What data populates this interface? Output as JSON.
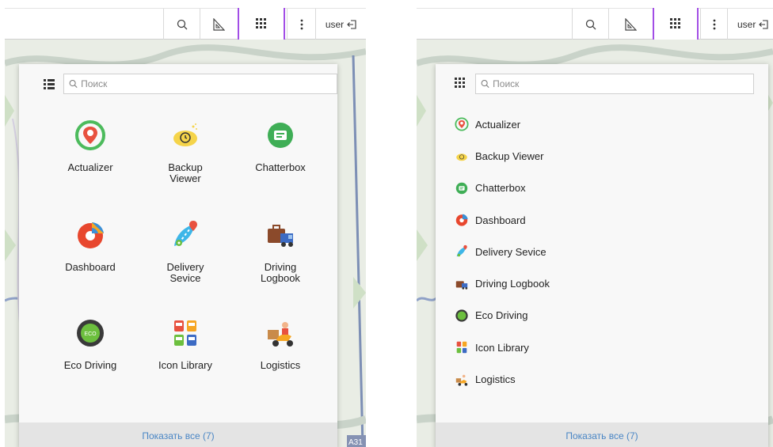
{
  "toolbar": {
    "user_label": "user",
    "active_color": "#a24ee6"
  },
  "search": {
    "placeholder": "Поиск"
  },
  "apps": [
    {
      "label": "Actualizer",
      "icon": "actualizer-icon"
    },
    {
      "label": "Backup\nViewer",
      "list_label": "Backup Viewer",
      "icon": "backup-viewer-icon"
    },
    {
      "label": "Chatterbox",
      "icon": "chatterbox-icon"
    },
    {
      "label": "Dashboard",
      "icon": "dashboard-icon"
    },
    {
      "label": "Delivery\nSevice",
      "list_label": "Delivery Sevice",
      "icon": "delivery-service-icon"
    },
    {
      "label": "Driving\nLogbook",
      "list_label": "Driving Logbook",
      "icon": "driving-logbook-icon"
    },
    {
      "label": "Eco Driving",
      "icon": "eco-driving-icon"
    },
    {
      "label": "Icon Library",
      "icon": "icon-library-icon"
    },
    {
      "label": "Logistics",
      "icon": "logistics-icon"
    }
  ],
  "footer": {
    "show_all": "Показать все (7)"
  },
  "map": {
    "road_label": "A31"
  }
}
